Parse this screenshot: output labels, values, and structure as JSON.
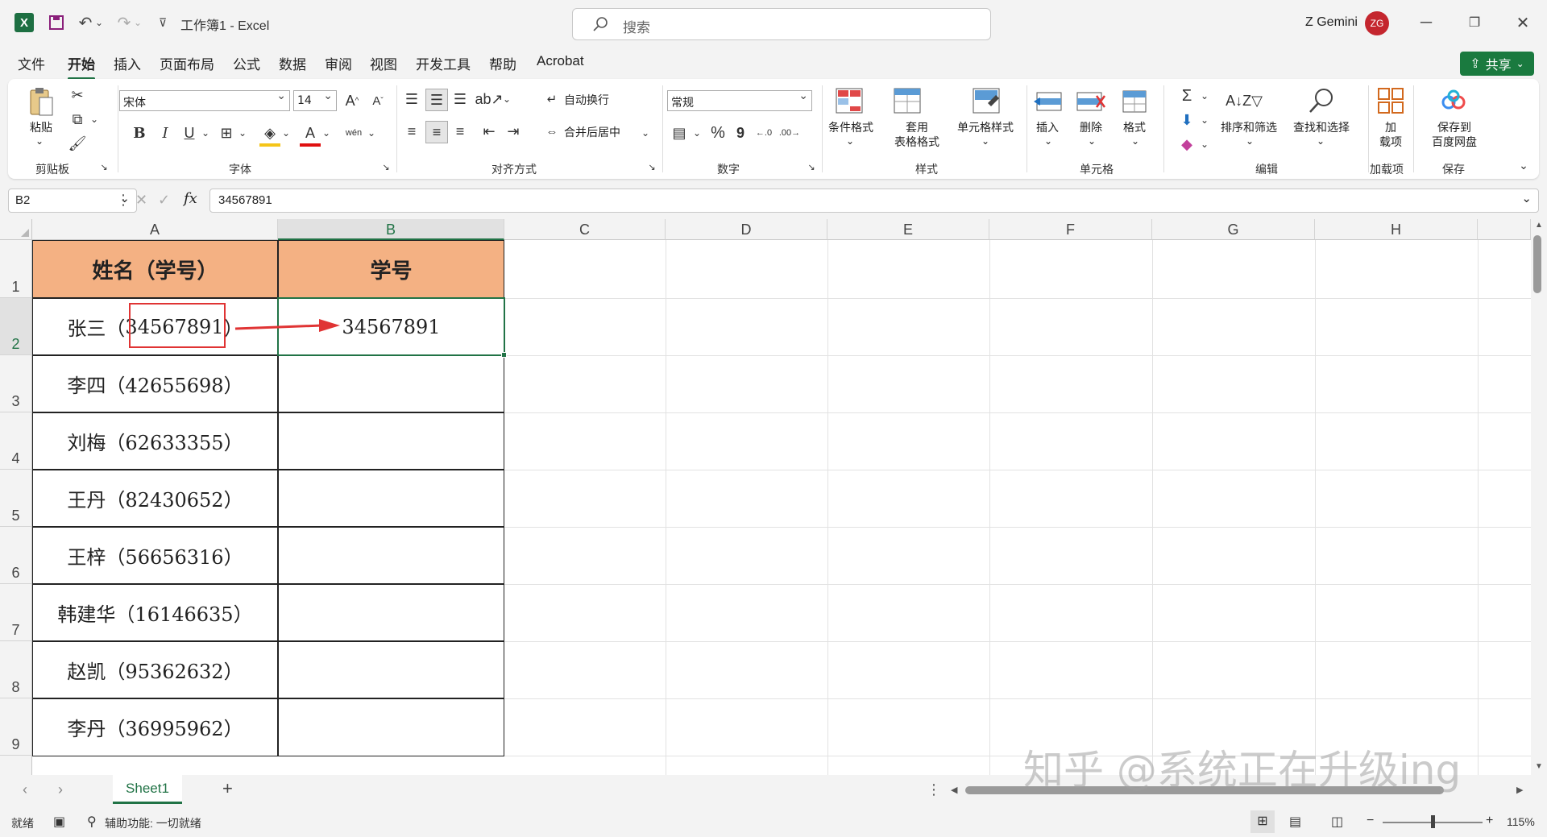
{
  "title": {
    "app": "工作簿1  -  Excel",
    "search_placeholder": "搜索",
    "user_name": "Z Gemini",
    "user_initials": "ZG"
  },
  "menu": {
    "tabs": [
      "文件",
      "开始",
      "插入",
      "页面布局",
      "公式",
      "数据",
      "审阅",
      "视图",
      "开发工具",
      "帮助",
      "Acrobat"
    ],
    "active": "开始",
    "share": "共享"
  },
  "ribbon": {
    "clipboard": {
      "paste": "粘贴",
      "label": "剪贴板"
    },
    "font": {
      "name": "宋体",
      "size": "14",
      "label": "字体",
      "bold": "B",
      "italic": "I",
      "underline": "U",
      "wen": "wén"
    },
    "align": {
      "wrap": "自动换行",
      "merge": "合并后居中",
      "label": "对齐方式"
    },
    "number": {
      "format": "常规",
      "label": "数字",
      "percent": "%",
      "comma": "9"
    },
    "styles": {
      "cond": "条件格式",
      "table1": "套用",
      "table2": "表格格式",
      "cell": "单元格样式",
      "label": "样式"
    },
    "cells": {
      "insert": "插入",
      "delete": "删除",
      "format": "格式",
      "label": "单元格"
    },
    "edit": {
      "sortfilter": "排序和筛选",
      "findselect": "查找和选择",
      "label": "编辑",
      "sigma": "Σ"
    },
    "addins": {
      "btn1": "加",
      "btn2": "载项",
      "label": "加载项"
    },
    "save": {
      "btn1": "保存到",
      "btn2": "百度网盘",
      "label": "保存"
    }
  },
  "formula": {
    "namebox": "B2",
    "fx": "fx",
    "value": "34567891"
  },
  "columns": [
    "A",
    "B",
    "C",
    "D",
    "E",
    "F",
    "G",
    "H"
  ],
  "rows": [
    "1",
    "2",
    "3",
    "4",
    "5",
    "6",
    "7",
    "8",
    "9"
  ],
  "table": {
    "header": [
      "姓名（学号）",
      "学号"
    ],
    "names": [
      "张三（34567891）",
      "李四（42655698）",
      "刘梅（62633355）",
      "王丹（82430652）",
      "王梓（56656316）",
      "韩建华（16146635）",
      "赵凯（95362632）",
      "李丹（36995962）"
    ],
    "row2_name_prefix": "张三（",
    "row2_name_number": "34567891",
    "row2_name_suffix": "）",
    "b2": "34567891"
  },
  "sheet": {
    "tab": "Sheet1",
    "add": "+"
  },
  "status": {
    "ready": "就绪",
    "accessibility": "辅助功能: 一切就绪",
    "zoom": "115%"
  },
  "watermark": "知乎 @系统正在升级ing",
  "colors": {
    "accent": "#217346",
    "header_fill": "#f4b183",
    "annotation": "#e03434"
  }
}
